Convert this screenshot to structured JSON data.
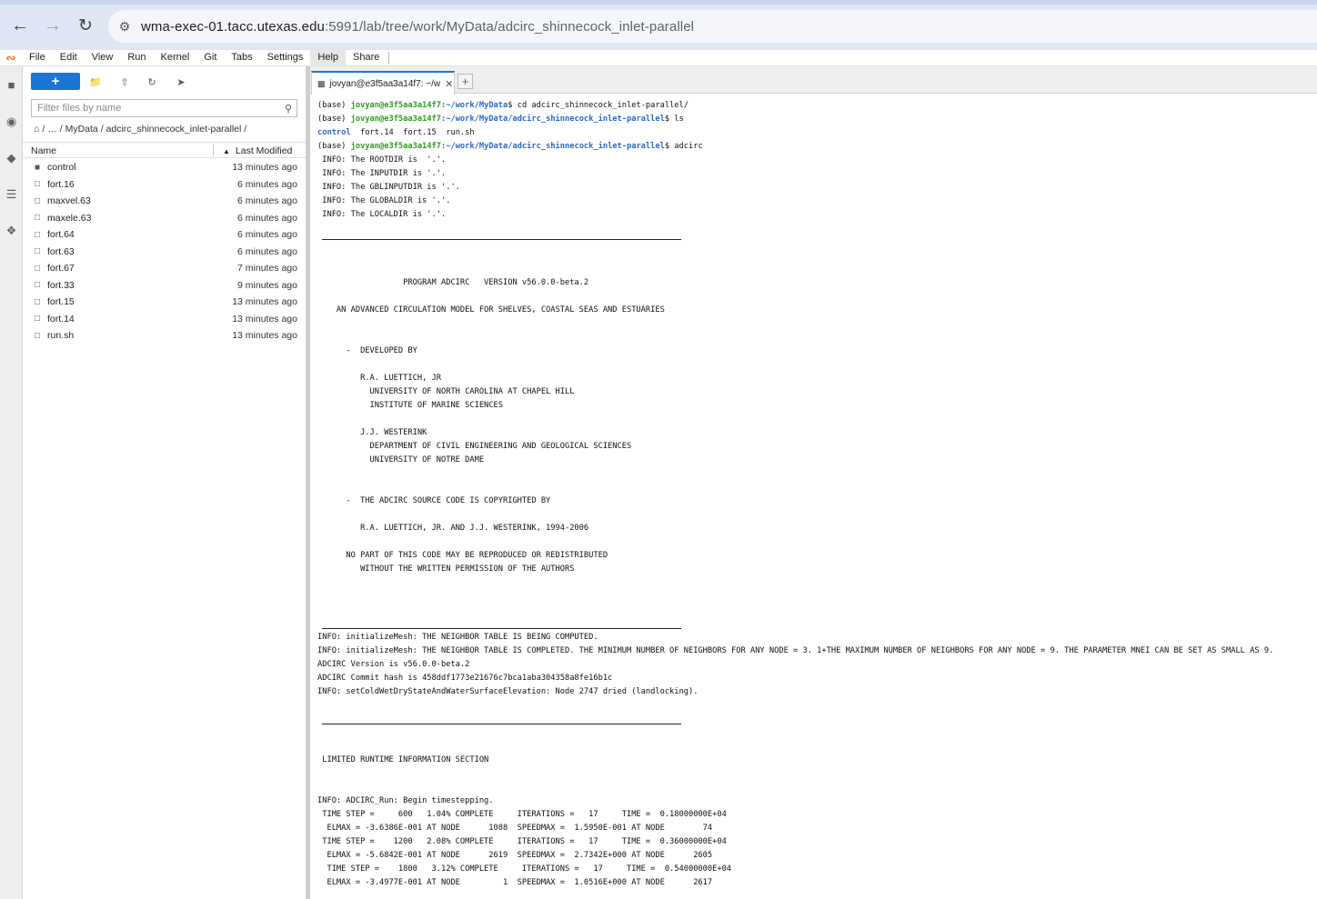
{
  "browser": {
    "url_host": "wma-exec-01.tacc.utexas.edu",
    "url_rest": ":5991/lab/tree/work/MyData/adcirc_shinnecock_inlet-parallel"
  },
  "menubar": {
    "items": [
      "File",
      "Edit",
      "View",
      "Run",
      "Kernel",
      "Git",
      "Tabs",
      "Settings",
      "Help",
      "Share"
    ]
  },
  "filebrowser": {
    "new_button": "+",
    "filter_placeholder": "Filter files by name",
    "breadcrumb": [
      "/",
      "…",
      "/ MyData / adcirc_shinnecock_inlet-parallel /"
    ],
    "col_name": "Name",
    "col_modified": "Last Modified",
    "files": [
      {
        "name": "control",
        "modified": "13 minutes ago",
        "type": "folder"
      },
      {
        "name": "fort.16",
        "modified": "6 minutes ago",
        "type": "file"
      },
      {
        "name": "maxvel.63",
        "modified": "6 minutes ago",
        "type": "file"
      },
      {
        "name": "maxele.63",
        "modified": "6 minutes ago",
        "type": "file"
      },
      {
        "name": "fort.64",
        "modified": "6 minutes ago",
        "type": "file"
      },
      {
        "name": "fort.63",
        "modified": "6 minutes ago",
        "type": "file"
      },
      {
        "name": "fort.67",
        "modified": "7 minutes ago",
        "type": "file"
      },
      {
        "name": "fort.33",
        "modified": "9 minutes ago",
        "type": "file"
      },
      {
        "name": "fort.15",
        "modified": "13 minutes ago",
        "type": "file"
      },
      {
        "name": "fort.14",
        "modified": "13 minutes ago",
        "type": "file"
      },
      {
        "name": "run.sh",
        "modified": "13 minutes ago",
        "type": "file"
      }
    ]
  },
  "tab": {
    "title": "jovyan@e3f5aa3a14f7: ~/w"
  },
  "terminal": {
    "prompt_base": "(base) ",
    "prompt_user": "jovyan@e3f5aa3a14f7",
    "path1": ":~/work/MyData",
    "cmd1": "$ cd adcirc_shinnecock_inlet-parallel/",
    "path2": ":~/work/MyData/adcirc_shinnecock_inlet-parallel",
    "cmd2": "$ ls",
    "ls_dir": "control",
    "ls_files": "  fort.14  fort.15  run.sh",
    "cmd3": "$ adcirc",
    "lines_a": [
      " INFO: The ROOTDIR is  '.'.",
      " INFO: The INPUTDIR is '.'.",
      " INFO: The GBLINPUTDIR is '.'.",
      " INFO: The GLOBALDIR is '.'.",
      " INFO: The LOCALDIR is '.'."
    ],
    "banner": [
      "                  PROGRAM ADCIRC   VERSION v56.0.0-beta.2",
      "    AN ADVANCED CIRCULATION MODEL FOR SHELVES, COASTAL SEAS AND ESTUARIES",
      "      -  DEVELOPED BY",
      "         R.A. LUETTICH, JR",
      "           UNIVERSITY OF NORTH CAROLINA AT CHAPEL HILL",
      "           INSTITUTE OF MARINE SCIENCES",
      "         J.J. WESTERINK",
      "           DEPARTMENT OF CIVIL ENGINEERING AND GEOLOGICAL SCIENCES",
      "           UNIVERSITY OF NOTRE DAME",
      "      -  THE ADCIRC SOURCE CODE IS COPYRIGHTED BY",
      "         R.A. LUETTICH, JR. AND J.J. WESTERINK, 1994-2006",
      "      NO PART OF THIS CODE MAY BE REPRODUCED OR REDISTRIBUTED",
      "         WITHOUT THE WRITTEN PERMISSION OF THE AUTHORS"
    ],
    "lines_b": [
      "INFO: initializeMesh: THE NEIGHBOR TABLE IS BEING COMPUTED.",
      "INFO: initializeMesh: THE NEIGHBOR TABLE IS COMPLETED. THE MINIMUM NUMBER OF NEIGHBORS FOR ANY NODE = 3. 1+THE MAXIMUM NUMBER OF NEIGHBORS FOR ANY NODE = 9. THE PARAMETER MNEI CAN BE SET AS SMALL AS 9.",
      "ADCIRC Version is v56.0.0-beta.2",
      "ADCIRC Commit hash is 458ddf1773e21676c7bca1aba304358a8fe16b1c",
      "INFO: setColdWetDryStateAndWaterSurfaceElevation: Node 2747 dried (landlocking)."
    ],
    "section_title": " LIMITED RUNTIME INFORMATION SECTION",
    "lines_c": [
      "INFO: ADCIRC_Run: Begin timestepping.",
      " TIME STEP =     600   1.04% COMPLETE     ITERATIONS =   17     TIME =  0.18000000E+04",
      "  ELMAX = -3.6386E-001 AT NODE      1088  SPEEDMAX =  1.5950E-001 AT NODE        74",
      " TIME STEP =    1200   2.08% COMPLETE     ITERATIONS =   17     TIME =  0.36000000E+04",
      "  ELMAX = -5.6842E-001 AT NODE      2619  SPEEDMAX =  2.7342E+000 AT NODE      2605",
      "  TIME STEP =    1800   3.12% COMPLETE     ITERATIONS =   17     TIME =  0.54000000E+04",
      "  ELMAX = -3.4977E-001 AT NODE         1  SPEEDMAX =  1.0516E+000 AT NODE      2617"
    ]
  }
}
